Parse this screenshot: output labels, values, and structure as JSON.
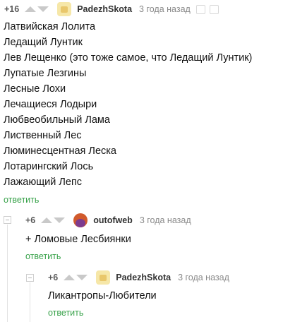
{
  "comments": [
    {
      "rating": "+16",
      "author": "PadezhSkota",
      "time": "3 года назад",
      "lines": [
        "Латвийская Лолита",
        "Ледащий Лунтик",
        "Лев Лещенко (это тоже самое, что Ледащий Лунтик)",
        "Лупатые Лезгины",
        "Лесные Лохи",
        "Лечащиеся Лодыри",
        "Любвеобильный Лама",
        "Лиственный Лес",
        "Люминесцентная Леска",
        "Лотарингский Лось",
        "Лажающий Лепс"
      ],
      "reply": "ответить"
    },
    {
      "rating": "+6",
      "author": "outofweb",
      "time": "3 года назад",
      "lines": [
        "+ Ломовые Лесбиянки"
      ],
      "reply": "ответить"
    },
    {
      "rating": "+6",
      "author": "PadezhSkota",
      "time": "3 года назад",
      "lines": [
        "Ликантропы-Любители"
      ],
      "reply": "ответить"
    }
  ],
  "icons": {
    "upvote": "arrow-up-icon",
    "downvote": "arrow-down-icon",
    "collapse": "minus-box-icon",
    "save": "save-icon",
    "more": "more-icon"
  },
  "colors": {
    "reply_link": "#38a24a",
    "meta": "#8a8a8a",
    "vote_arrow": "#c9c9c9"
  }
}
